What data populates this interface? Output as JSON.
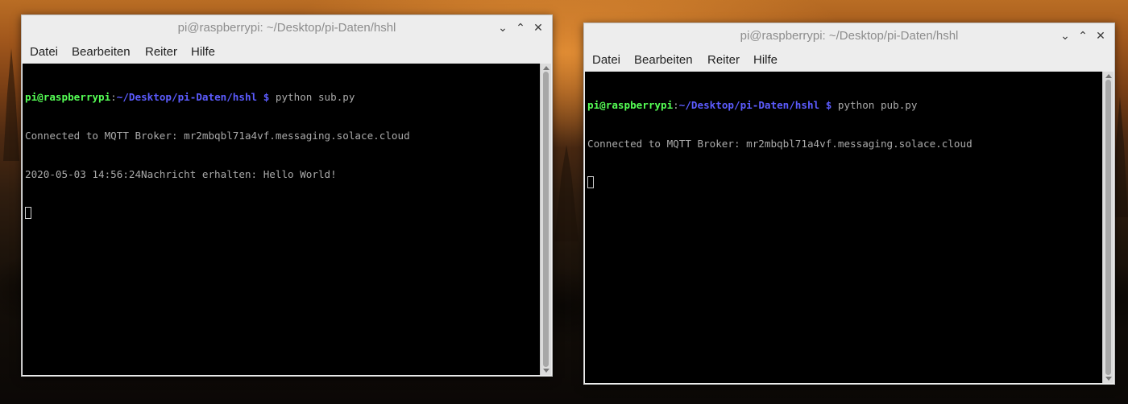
{
  "windows": [
    {
      "title": "pi@raspberrypi: ~/Desktop/pi-Daten/hshl",
      "menu": [
        "Datei",
        "Bearbeiten",
        "Reiter",
        "Hilfe"
      ],
      "prompt": {
        "user": "pi@raspberrypi",
        "sep": ":",
        "path": "~/Desktop/pi-Daten/hshl",
        "dollar": " $",
        "command": " python sub.py"
      },
      "output": [
        "Connected to MQTT Broker: mr2mbqbl71a4vf.messaging.solace.cloud",
        "2020-05-03 14:56:24Nachricht erhalten: Hello World!"
      ]
    },
    {
      "title": "pi@raspberrypi: ~/Desktop/pi-Daten/hshl",
      "menu": [
        "Datei",
        "Bearbeiten",
        "Reiter",
        "Hilfe"
      ],
      "prompt": {
        "user": "pi@raspberrypi",
        "sep": ":",
        "path": "~/Desktop/pi-Daten/hshl",
        "dollar": " $",
        "command": " python pub.py"
      },
      "output": [
        "Connected to MQTT Broker: mr2mbqbl71a4vf.messaging.solace.cloud"
      ]
    }
  ],
  "icons": {
    "minimize": "chevron-down-icon",
    "maximize": "chevron-up-icon",
    "close": "close-icon"
  },
  "colors": {
    "prompt_user": "#55ff55",
    "prompt_path": "#5c5cff",
    "terminal_bg": "#000000",
    "terminal_text": "#aaaaaa"
  }
}
